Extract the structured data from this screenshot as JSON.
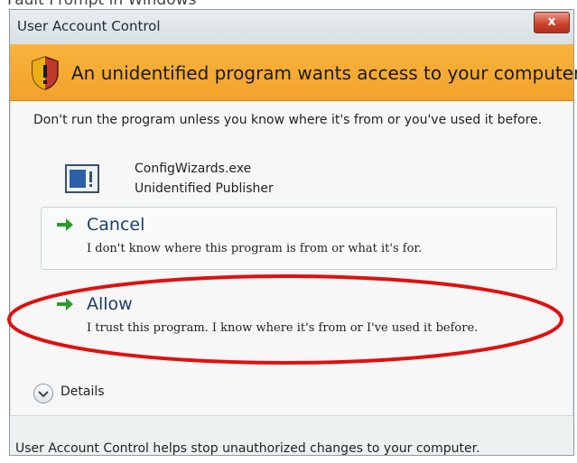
{
  "top_caption": "Fault Prompt in Windows",
  "dialog": {
    "title": "User Account Control",
    "close_label": "x",
    "banner_text": "An unidentified program wants access to your computer",
    "message": "Don't run the program unless you know where it's from or you've used it before.",
    "program": {
      "name": "ConfigWizards.exe",
      "publisher": "Unidentified Publisher",
      "icon": "application-icon"
    },
    "options": [
      {
        "title": "Cancel",
        "description": "I don't know where this program is from or what it's for.",
        "icon": "green-arrow-icon"
      },
      {
        "title": "Allow",
        "description": "I trust this program. I know where it's from or I've used it before.",
        "icon": "green-arrow-icon"
      }
    ],
    "details_label": "Details",
    "footer_text": "User Account Control helps stop unauthorized changes to your computer."
  },
  "colors": {
    "banner": "#f2a22a",
    "highlight": "#e01010",
    "option_title": "#1d3f66",
    "arrow": "#2e9a2a"
  }
}
